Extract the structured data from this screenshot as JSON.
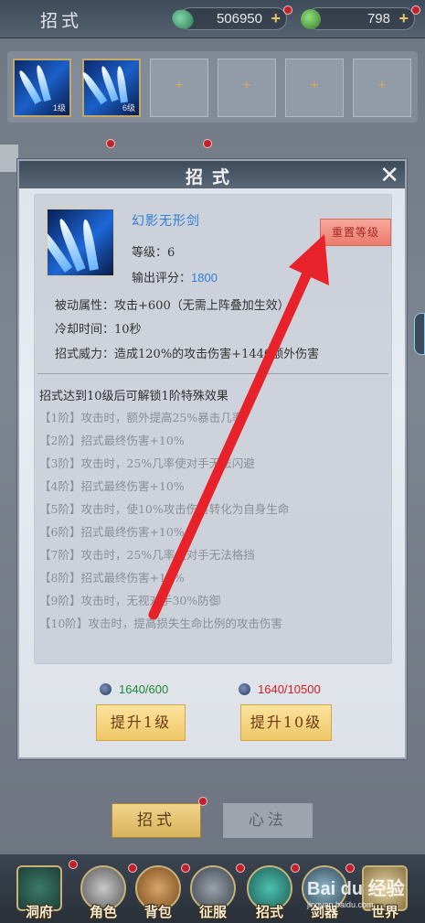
{
  "topbar": {
    "title": "招式",
    "currency1": "506950",
    "currency2": "798",
    "plus": "+"
  },
  "slots": [
    {
      "level": "1级"
    },
    {
      "level": "6级"
    }
  ],
  "modal": {
    "title": "招式",
    "close": "✕",
    "skill_name": "幻影无形剑",
    "level_label": "等级：",
    "level_value": "6",
    "score_label": "输出评分：",
    "score_value": "1800",
    "passive_label": "被动属性：",
    "passive_value": "攻击+600（无需上阵叠加生效）",
    "cooldown_label": "冷却时间：",
    "cooldown_value": "10秒",
    "power_label": "招式威力：",
    "power_value": "造成120%的攻击伤害+1440额外伤害",
    "reset_button": "重置等级",
    "tiers_header": "招式达到10级后可解锁1阶特殊效果",
    "tiers": [
      "【1阶】攻击时，额外提高25%暴击几率",
      "【2阶】招式最终伤害+10%",
      "【3阶】攻击时，25%几率使对手无法闪避",
      "【4阶】招式最终伤害+10%",
      "【5阶】攻击时，使10%攻击伤害转化为自身生命",
      "【6阶】招式最终伤害+10%",
      "【7阶】攻击时，25%几率使对手无法格挡",
      "【8阶】招式最终伤害+10%",
      "【9阶】攻击时，无视对手30%防御",
      "【10阶】攻击时，提高损失生命比例的攻击伤害"
    ],
    "cost1": "1640/600",
    "cost2": "1640/10500",
    "upgrade1": "提升1级",
    "upgrade10": "提升10级"
  },
  "tabs": {
    "active": "招式",
    "inactive": "心法"
  },
  "nav": [
    {
      "label": "洞府"
    },
    {
      "label": "角色"
    },
    {
      "label": "背包"
    },
    {
      "label": "征服"
    },
    {
      "label": "招式"
    },
    {
      "label": "剑器"
    },
    {
      "label": "世界"
    }
  ],
  "watermark": {
    "brand": "Bai du 经验",
    "url": "jingyan.baidu.com"
  },
  "colors": {
    "accent_blue": "#2f7fd9",
    "cost_green": "#1f8a36",
    "cost_red": "#d1201f",
    "arrow_red": "#e8222a",
    "button_gold": "#f0c766"
  }
}
